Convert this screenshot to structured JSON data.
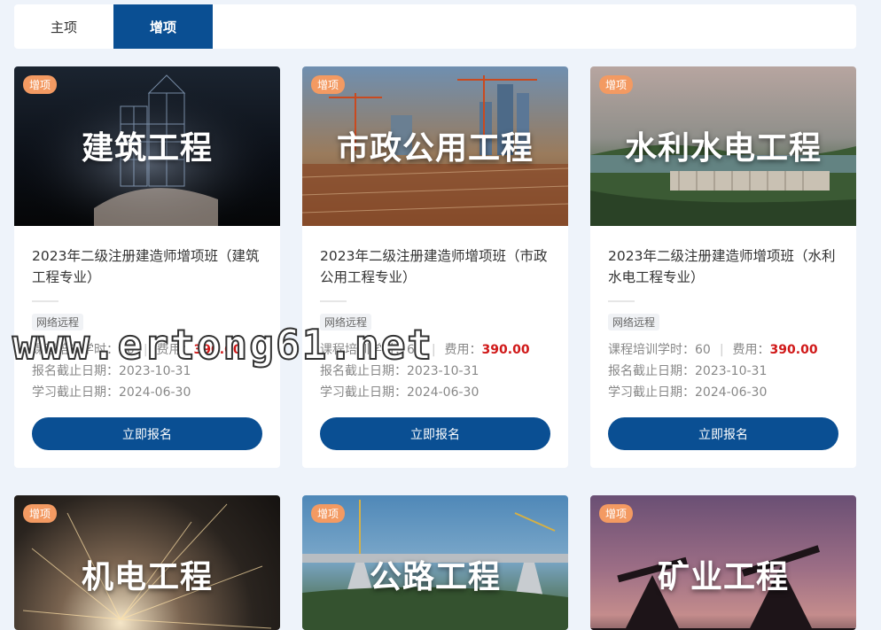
{
  "tabs": [
    {
      "label": "主项",
      "active": false
    },
    {
      "label": "增项",
      "active": true
    }
  ],
  "badge_label": "增项",
  "cards": [
    {
      "banner_title": "建筑工程",
      "course_title": "2023年二级注册建造师增项班（建筑工程专业）",
      "tag": "网络远程",
      "hours_label": "课程培训学时：",
      "hours": "60",
      "fee_label": "费用：",
      "fee": "390.00",
      "signup_deadline_label": "报名截止日期：",
      "signup_deadline": "2023-10-31",
      "study_deadline_label": "学习截止日期：",
      "study_deadline": "2024-06-30",
      "button_label": "立即报名"
    },
    {
      "banner_title": "市政公用工程",
      "course_title": "2023年二级注册建造师增项班（市政公用工程专业）",
      "tag": "网络远程",
      "hours_label": "课程培训学时：",
      "hours": "60",
      "fee_label": "费用：",
      "fee": "390.00",
      "signup_deadline_label": "报名截止日期：",
      "signup_deadline": "2023-10-31",
      "study_deadline_label": "学习截止日期：",
      "study_deadline": "2024-06-30",
      "button_label": "立即报名"
    },
    {
      "banner_title": "水利水电工程",
      "course_title": "2023年二级注册建造师增项班（水利水电工程专业）",
      "tag": "网络远程",
      "hours_label": "课程培训学时：",
      "hours": "60",
      "fee_label": "费用：",
      "fee": "390.00",
      "signup_deadline_label": "报名截止日期：",
      "signup_deadline": "2023-10-31",
      "study_deadline_label": "学习截止日期：",
      "study_deadline": "2024-06-30",
      "button_label": "立即报名"
    },
    {
      "banner_title": "机电工程"
    },
    {
      "banner_title": "公路工程"
    },
    {
      "banner_title": "矿业工程"
    }
  ],
  "watermark": "www.ertong61.net",
  "colors": {
    "primary": "#0a4f93",
    "badge": "#f39a62",
    "fee": "#d01818",
    "page_bg": "#eef3fa"
  }
}
